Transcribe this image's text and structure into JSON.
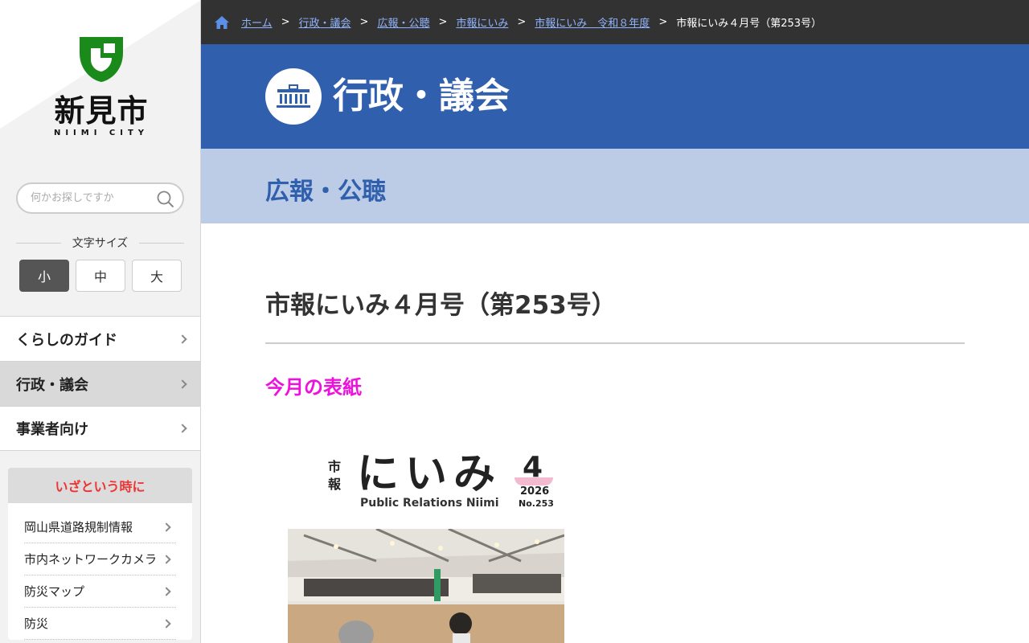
{
  "sidebar": {
    "logo": {
      "jp": "新見市",
      "en": "NIIMI CITY"
    },
    "search": {
      "placeholder": "何かお探しですか"
    },
    "font_size": {
      "label": "文字サイズ",
      "small": "小",
      "medium": "中",
      "large": "大",
      "selected": "small"
    },
    "nav": [
      {
        "label": "くらしのガイド"
      },
      {
        "label": "行政・議会"
      },
      {
        "label": "事業者向け"
      }
    ],
    "emergency": {
      "title": "いざという時に",
      "items": [
        {
          "label": "岡山県道路規制情報"
        },
        {
          "label": "市内ネットワークカメラ"
        },
        {
          "label": "防災マップ"
        },
        {
          "label": "防災"
        }
      ]
    }
  },
  "breadcrumb": {
    "links": [
      "ホーム",
      "行政・議会",
      "広報・公聴",
      "市報にいみ",
      "市報にいみ　令和８年度"
    ],
    "current": "市報にいみ４月号（第253号）",
    "separator": ">"
  },
  "banner": {
    "title": "行政・議会",
    "icon": "government-building-icon"
  },
  "subbanner": {
    "title": "広報・公聴"
  },
  "article": {
    "title": "市報にいみ４月号（第253号）",
    "section": "今月の表紙"
  },
  "cover": {
    "ichi": "市",
    "ho": "報",
    "title": "にいみ",
    "subtitle": "Public Relations Niimi",
    "month": "4",
    "year": "2026",
    "number": "No.253"
  },
  "colors": {
    "crumbs_bg": "#333232",
    "banner_bg": "#3060ad",
    "subbanner_bg": "#bccce6",
    "section_title": "#ee11dd",
    "emergency_title": "#ee3333",
    "logo_green": "#1a8a1a"
  }
}
